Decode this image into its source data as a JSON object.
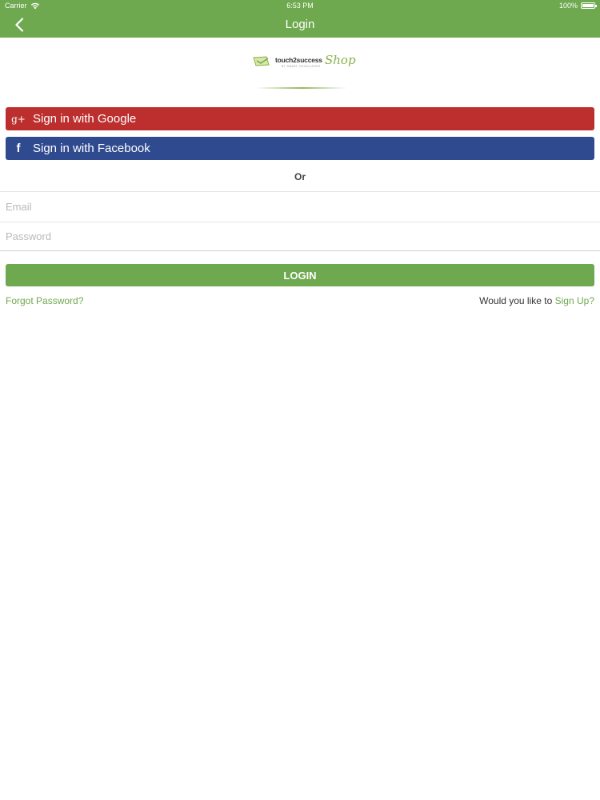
{
  "status_bar": {
    "carrier": "Carrier",
    "time": "6:53 PM",
    "battery": "100%"
  },
  "nav": {
    "title": "Login",
    "back_icon": "chevron-left-icon"
  },
  "logo": {
    "text": "touch2success",
    "subtext": "BY SMART, EXCELLENCE",
    "script": "Shop"
  },
  "social": {
    "google": {
      "label": "Sign in with Google",
      "icon": "google-plus-icon",
      "icon_glyph": "g+",
      "color": "#bd2f2e"
    },
    "facebook": {
      "label": "Sign in with Facebook",
      "icon": "facebook-icon",
      "icon_glyph": "f",
      "color": "#2f4a8e"
    }
  },
  "divider_text": "Or",
  "form": {
    "email": {
      "placeholder": "Email",
      "value": ""
    },
    "password": {
      "placeholder": "Password",
      "value": ""
    },
    "login_label": "LOGIN"
  },
  "links": {
    "forgot_password": "Forgot Password?",
    "signup_prompt": "Would you like to",
    "signup": "Sign Up?"
  },
  "colors": {
    "brand_green": "#6ea84f",
    "google_red": "#bd2f2e",
    "facebook_blue": "#2f4a8e"
  }
}
